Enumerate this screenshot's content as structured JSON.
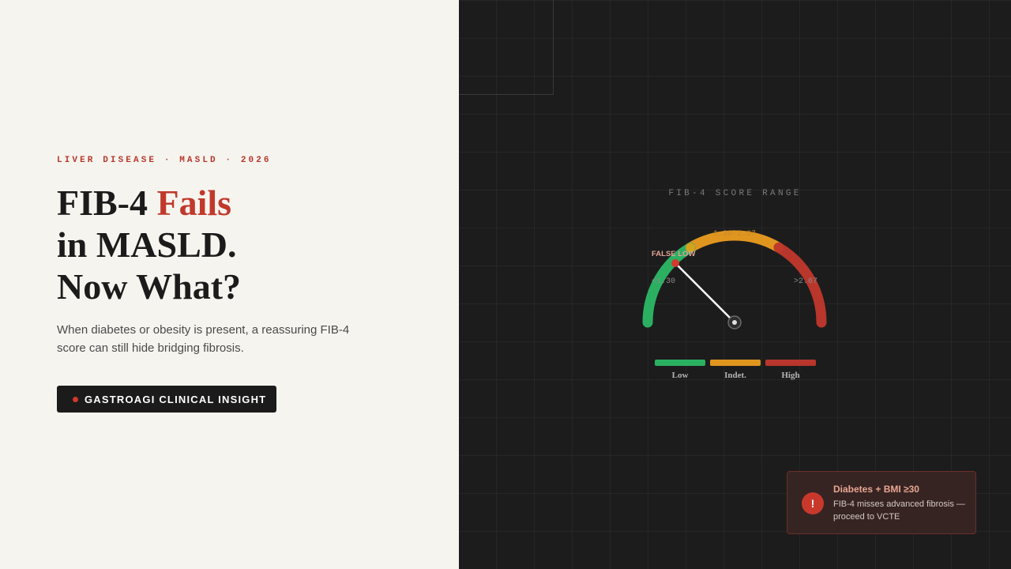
{
  "hero": {
    "eyebrow": "LIVER DISEASE · MASLD · 2026",
    "headline_part1": "FIB-4 ",
    "headline_accent": "Fails",
    "headline_line2": "in MASLD.",
    "headline_line3": "Now What?",
    "subtext": "When diabetes or obesity is present, a reassuring FIB-4 score can still hide bridging fibrosis.",
    "cta_label": "GASTROAGI CLINICAL INSIGHT",
    "accent_color": "#c0392b"
  },
  "gauge": {
    "title": "FIB-4 SCORE RANGE",
    "zones": [
      {
        "range_label": "<1.30",
        "legend": "Low",
        "color": "#2bb062"
      },
      {
        "range_label": "1.30–2.67",
        "legend": "Indet.",
        "color": "#e0951f"
      },
      {
        "range_label": ">2.67",
        "legend": "High",
        "color": "#b8362b"
      }
    ],
    "needle_label": "FALSE LOW",
    "needle_fraction": 0.25,
    "needle_color": "#d23a2c"
  },
  "alert": {
    "icon": "exclamation-icon",
    "icon_glyph": "!",
    "title": "Diabetes + BMI ≥30",
    "body": "FIB-4 misses advanced fibrosis — proceed to VCTE"
  }
}
